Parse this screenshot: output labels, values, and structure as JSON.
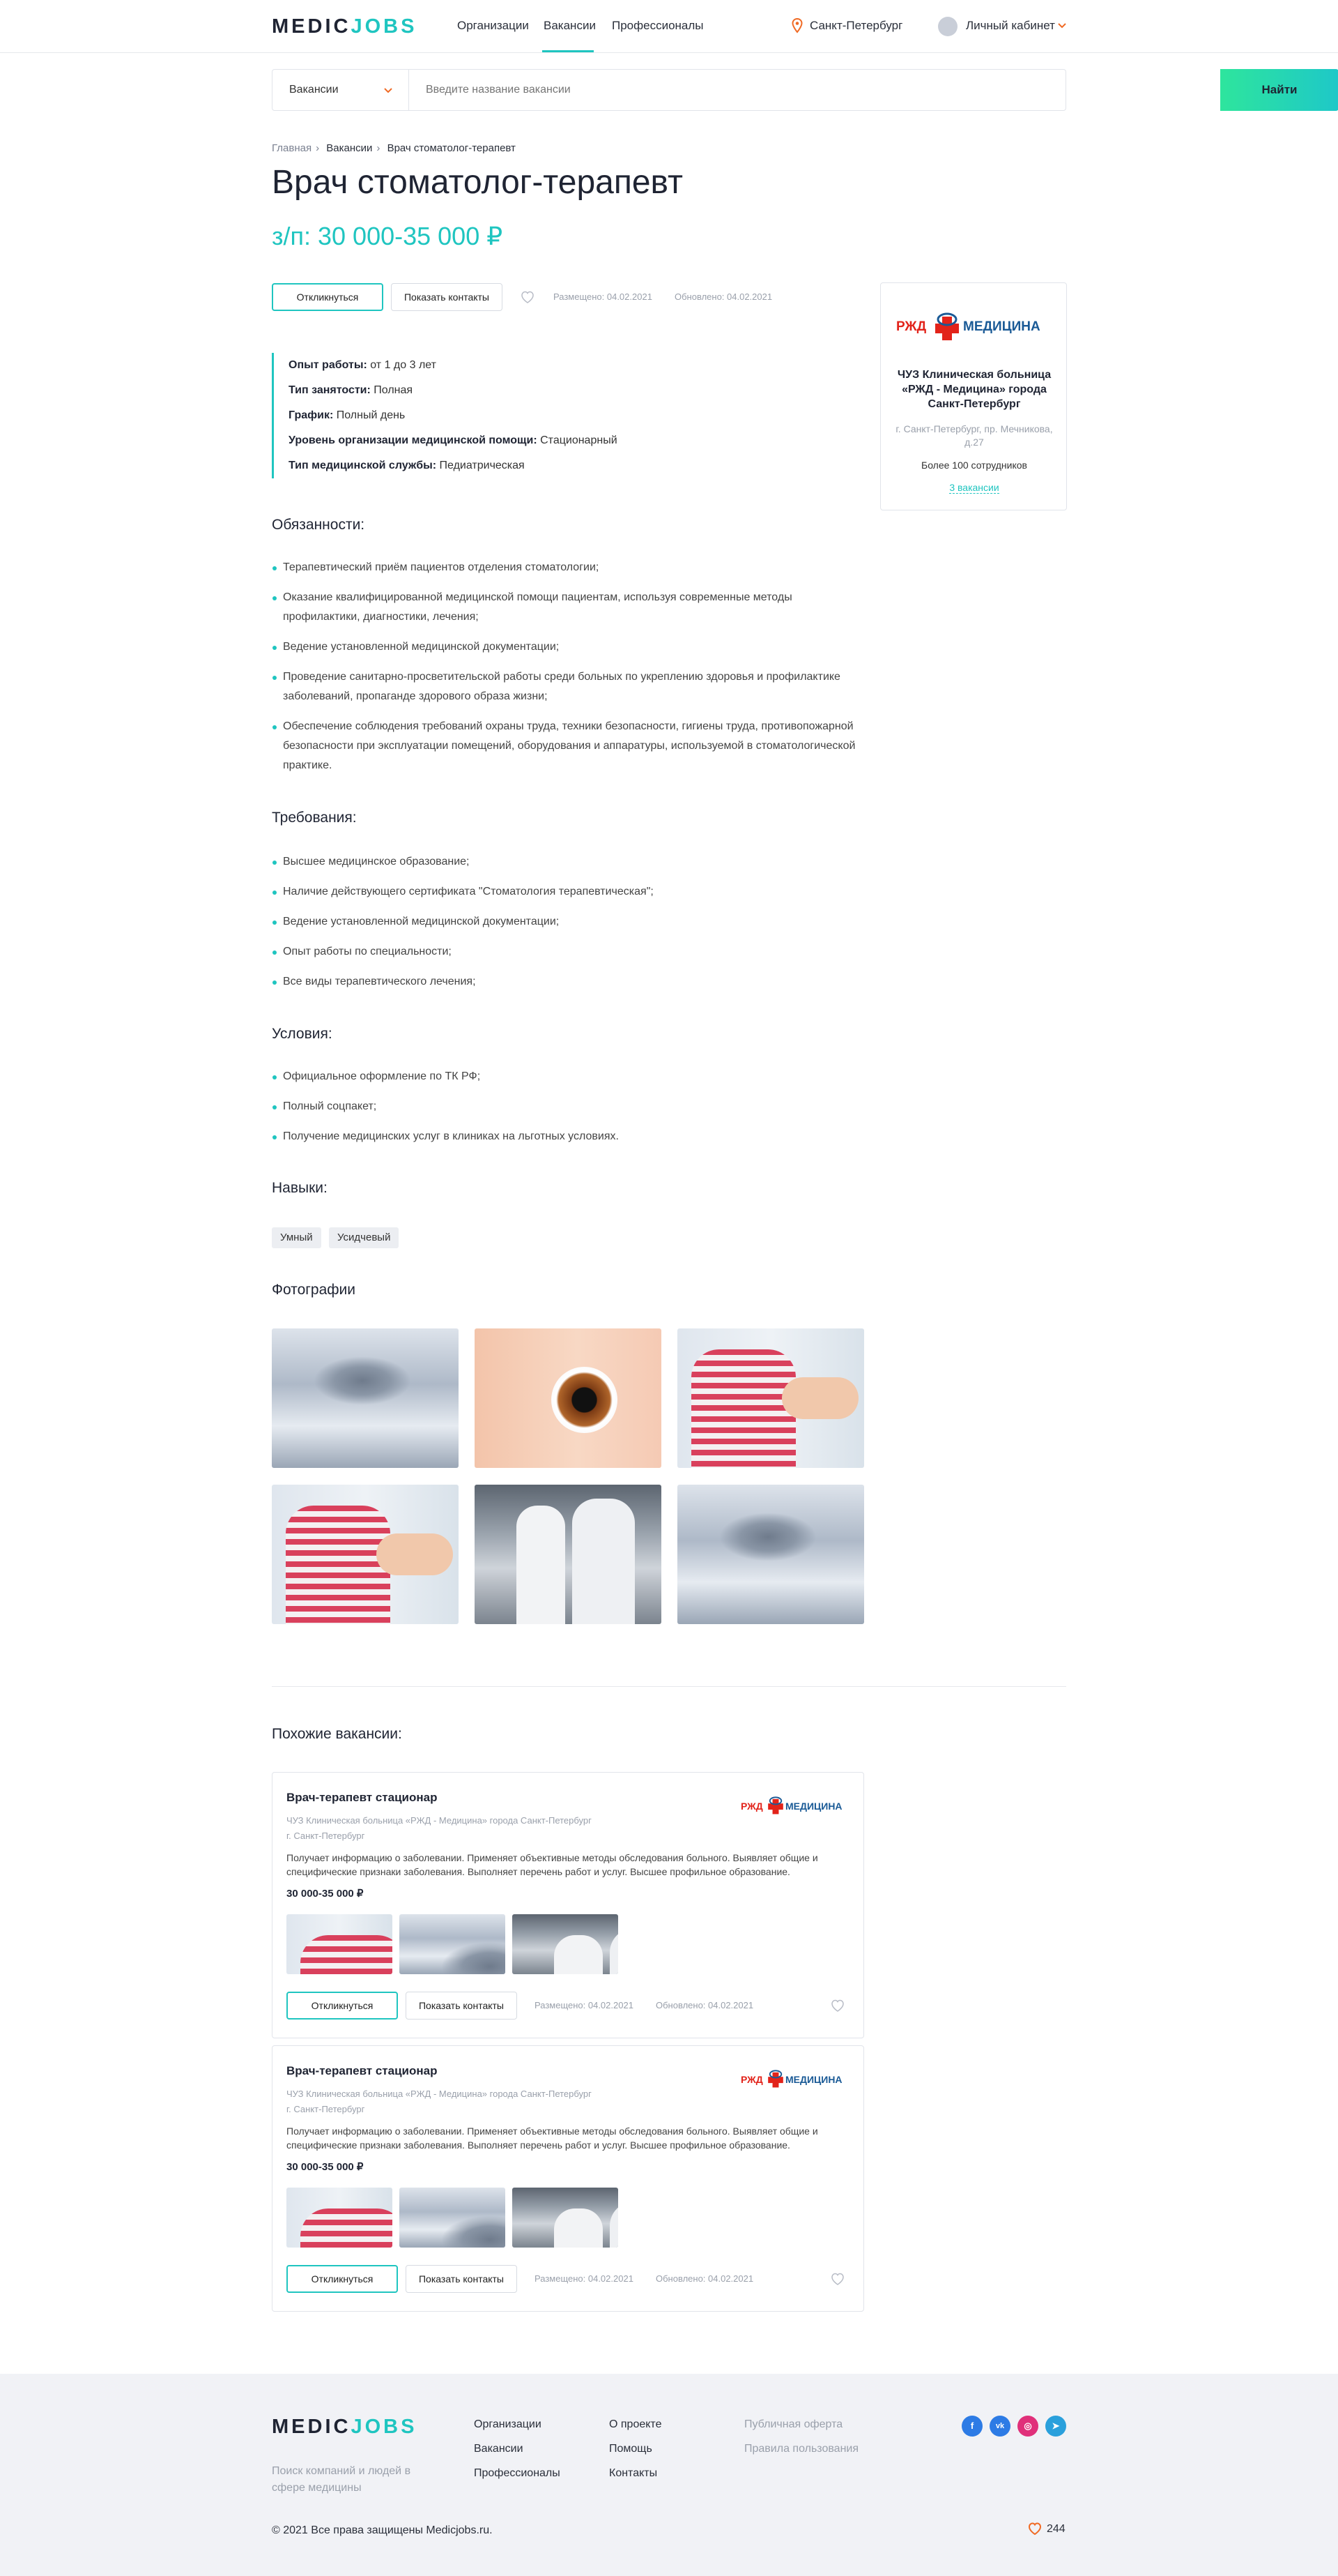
{
  "header": {
    "logo_part1": "MEDIC",
    "logo_part2": "JOBS",
    "nav": [
      "Организации",
      "Вакансии",
      "Профессионалы"
    ],
    "city": "Санкт-Петербург",
    "cabinet": "Личный кабинет"
  },
  "search": {
    "category": "Вакансии",
    "placeholder": "Введите название вакансии",
    "button": "Найти"
  },
  "breadcrumbs": [
    "Главная",
    "Вакансии",
    "Врач стоматолог-терапевт"
  ],
  "vacancy": {
    "title": "Врач стоматолог-терапевт",
    "salary": "з/п: 30 000-35 000 ₽",
    "respond": "Откликнуться",
    "show_contacts": "Показать контакты",
    "posted": "Размещено: 04.02.2021",
    "updated": "Обновлено: 04.02.2021",
    "info": [
      {
        "label": "Опыт работы:",
        "value": " от 1 до 3 лет"
      },
      {
        "label": "Тип занятости:",
        "value": " Полная"
      },
      {
        "label": "График:",
        "value": " Полный день"
      },
      {
        "label": "Уровень организации медицинской помощи:",
        "value": " Стационарный"
      },
      {
        "label": "Тип медицинской службы:",
        "value": " Педиатрическая"
      }
    ]
  },
  "company": {
    "logo_left": "РЖД",
    "logo_right": "МЕДИЦИНА",
    "name": "ЧУЗ Клиническая больница «РЖД - Медицина» города Санкт-Петербург",
    "address": "г. Санкт-Петербург, пр. Мечникова, д.27",
    "employees": "Более 100 сотрудников",
    "vacancies": "3 вакансии"
  },
  "sections": {
    "duties_title": "Обязанности:",
    "duties": [
      "Терапевтический приём пациентов отделения стоматологии;",
      "Оказание квалифицированной медицинской помощи пациентам, используя современные методы профилактики, диагностики, лечения;",
      "Ведение установленной медицинской документации;",
      "Проведение санитарно-просветительской работы среди больных по укреплению здоровья и профилактике заболеваний, пропаганде здорового образа жизни;",
      "Обеспечение соблюдения требований охраны труда, техники безопасности, гигиены труда, противопожарной безопасности при эксплуатации помещений, оборудования и аппаратуры, используемой в стоматологической практике."
    ],
    "req_title": "Требования:",
    "requirements": [
      "Высшее медицинское образование;",
      "Наличие действующего сертификата \"Стоматология терапевтическая\";",
      "Ведение установленной медицинской документации;",
      "Опыт работы по специальности;",
      "Все виды терапевтического лечения;"
    ],
    "cond_title": "Условия:",
    "conditions": [
      "Официальное оформление по ТК РФ;",
      "Полный соцпакет;",
      "Получение медицинских услуг в клиниках на льготных условиях."
    ],
    "skills_title": "Навыки:",
    "skills": [
      "Умный",
      "Усидчевый"
    ],
    "photos_title": "Фотографии"
  },
  "similar": {
    "title": "Похожие вакансии:",
    "items": [
      {
        "title": "Врач-терапевт стационар",
        "company": "ЧУЗ Клиническая больница «РЖД - Медицина» города Санкт-Петербург",
        "city": "г. Санкт-Петербург",
        "description": "Получает информацию о заболевании. Применяет объективные методы обследования больного. Выявляет общие и специфические признаки заболевания. Выполняет перечень работ и услуг. Высшее профильное образование.",
        "salary": "30 000-35 000 ₽",
        "respond": "Откликнуться",
        "show_contacts": "Показать контакты",
        "posted": "Размещено: 04.02.2021",
        "updated": "Обновлено: 04.02.2021"
      },
      {
        "title": "Врач-терапевт стационар",
        "company": "ЧУЗ Клиническая больница «РЖД - Медицина» города Санкт-Петербург",
        "city": "г. Санкт-Петербург",
        "description": "Получает информацию о заболевании. Применяет объективные методы обследования больного. Выявляет общие и специфические признаки заболевания. Выполняет перечень работ и услуг. Высшее профильное образование.",
        "salary": "30 000-35 000 ₽",
        "respond": "Откликнуться",
        "show_contacts": "Показать контакты",
        "posted": "Размещено: 04.02.2021",
        "updated": "Обновлено: 04.02.2021"
      }
    ]
  },
  "footer": {
    "tagline": "Поиск компаний и людей в сфере медицины",
    "col1": [
      "Организации",
      "Вакансии",
      "Профессионалы"
    ],
    "col2": [
      "О проекте",
      "Помощь",
      "Контакты"
    ],
    "col3": [
      "Публичная оферта",
      "Правила пользования"
    ],
    "copyright": "© 2021 Все права защищены Medicjobs.ru.",
    "likes": "244"
  },
  "colors": {
    "accent": "#1fc5c0",
    "brand_dark": "#1f2433",
    "rzd_red": "#e2231a",
    "rzd_blue": "#1a5a96"
  }
}
